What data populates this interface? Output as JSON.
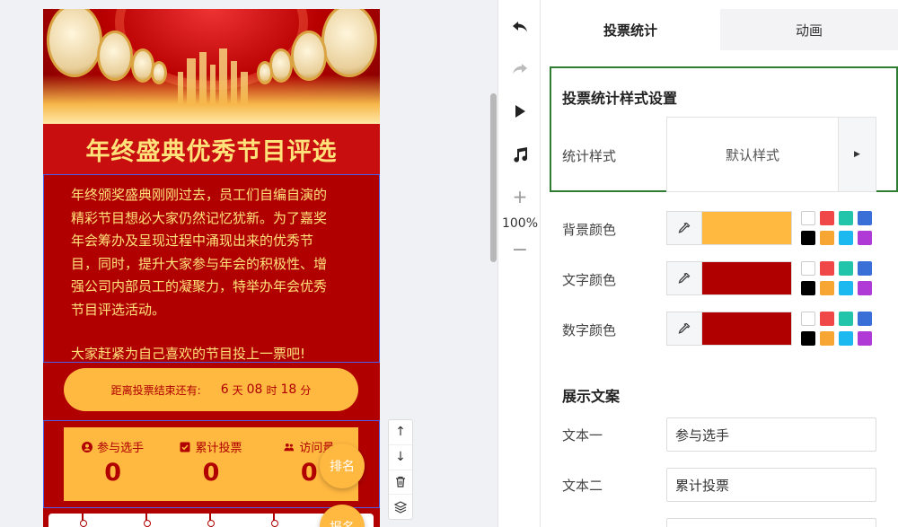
{
  "preview": {
    "title": "年终盛典优秀节目评选",
    "intro_lines": [
      "年终颁奖盛典刚刚过去，员工们自编自演的",
      "精彩节目想必大家仍然记忆犹新。为了嘉奖",
      "年会筹办及呈现过程中涌现出来的优秀节",
      "目，同时，提升大家参与年会的积极性、增",
      "强公司内部员工的凝聚力，特举办年会优秀",
      "节目评选活动。"
    ],
    "intro_call": "大家赶紧为自己喜欢的节目投上一票吧!",
    "countdown": {
      "label": "距离投票结束还有:",
      "days": "6",
      "days_unit": "天",
      "hours": "08",
      "hours_unit": "时",
      "minutes": "18",
      "minutes_unit": "分"
    },
    "stats": [
      {
        "label": "参与选手",
        "value": "0",
        "icon": "user-circle-icon"
      },
      {
        "label": "累计投票",
        "value": "0",
        "icon": "checkbox-icon"
      },
      {
        "label": "访问量",
        "value": "0",
        "icon": "group-icon"
      }
    ],
    "float_rank": "排名",
    "float_signup": "报名"
  },
  "toolbar": {
    "zoom": "100%"
  },
  "panel": {
    "tabs": [
      {
        "label": "投票统计",
        "active": true
      },
      {
        "label": "动画",
        "active": false
      }
    ],
    "style_section": {
      "title": "投票统计样式设置",
      "style_label": "统计样式",
      "style_value": "默认样式"
    },
    "colors": [
      {
        "label": "背景颜色",
        "value": "#ffb840"
      },
      {
        "label": "文字颜色",
        "value": "#b00000"
      },
      {
        "label": "数字颜色",
        "value": "#b00000"
      }
    ],
    "palette": [
      "#ffffff",
      "#f04848",
      "#22c4aa",
      "#3a6fd8",
      "#000000",
      "#f7a634",
      "#1cb8f0",
      "#b03ad6"
    ],
    "text_section": {
      "title": "展示文案",
      "items": [
        {
          "label": "文本一",
          "value": "参与选手"
        },
        {
          "label": "文本二",
          "value": "累计投票"
        }
      ]
    }
  }
}
